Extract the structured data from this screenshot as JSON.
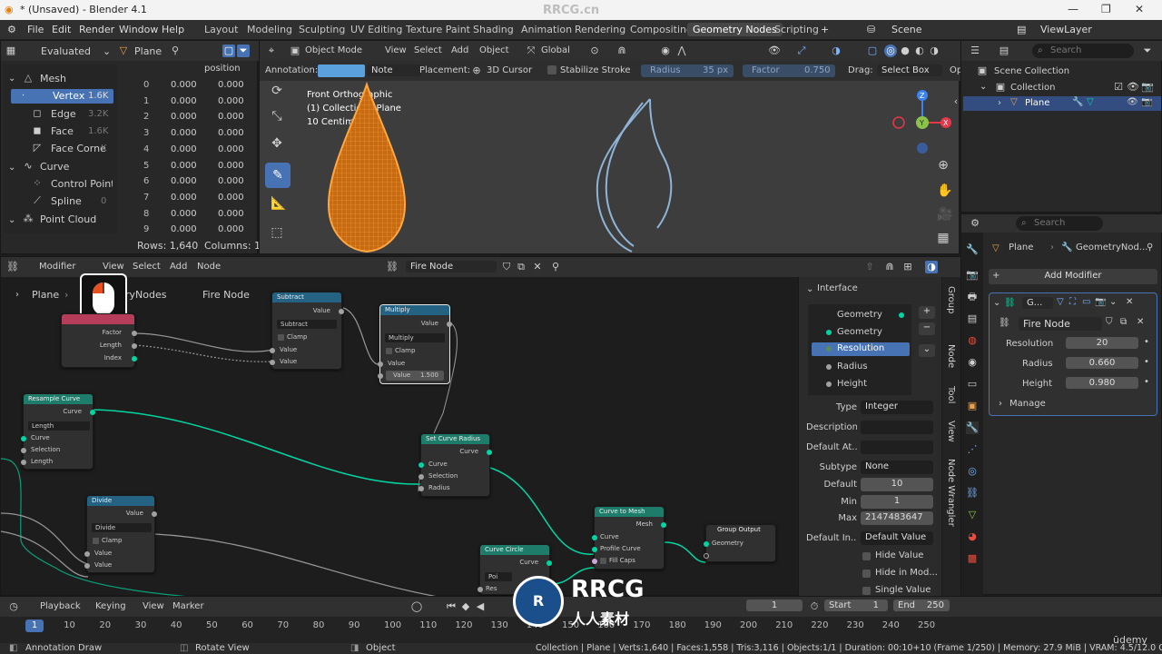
{
  "window": {
    "title": "* (Unsaved) - Blender 4.1"
  },
  "menu": {
    "items": [
      "File",
      "Edit",
      "Render",
      "Window",
      "Help"
    ]
  },
  "workspaces": [
    "Layout",
    "Modeling",
    "Sculpting",
    "UV Editing",
    "Texture Paint",
    "Shading",
    "Animation",
    "Rendering",
    "Compositing",
    "Geometry Nodes",
    "Scripting"
  ],
  "active_workspace": "Geometry Nodes",
  "scene": {
    "name": "Scene",
    "viewlayer": "ViewLayer"
  },
  "spreadsheet": {
    "mode": "Evaluated",
    "object": "Plane",
    "column": "position",
    "tree": [
      {
        "label": "Mesh",
        "count": ""
      },
      {
        "label": "Vertex",
        "count": "1.6K"
      },
      {
        "label": "Edge",
        "count": "3.2K"
      },
      {
        "label": "Face",
        "count": "1.6K"
      },
      {
        "label": "Face Corner",
        "count": "K"
      },
      {
        "label": "Curve",
        "count": ""
      },
      {
        "label": "Control Point",
        "count": ""
      },
      {
        "label": "Spline",
        "count": "0"
      },
      {
        "label": "Point Cloud",
        "count": ""
      }
    ],
    "rows": [
      {
        "i": "0",
        "a": "0.000",
        "b": "0.000"
      },
      {
        "i": "1",
        "a": "0.000",
        "b": "0.000"
      },
      {
        "i": "2",
        "a": "0.000",
        "b": "0.000"
      },
      {
        "i": "3",
        "a": "0.000",
        "b": "0.000"
      },
      {
        "i": "4",
        "a": "0.000",
        "b": "0.000"
      },
      {
        "i": "5",
        "a": "0.000",
        "b": "0.000"
      },
      {
        "i": "6",
        "a": "0.000",
        "b": "0.000"
      },
      {
        "i": "7",
        "a": "0.000",
        "b": "0.000"
      },
      {
        "i": "8",
        "a": "0.000",
        "b": "0.000"
      },
      {
        "i": "9",
        "a": "0.000",
        "b": "0.000"
      }
    ],
    "rows_label": "Rows: 1,640",
    "cols_label": "Columns: 1"
  },
  "viewport": {
    "mode": "Object Mode",
    "menus": [
      "View",
      "Select",
      "Add",
      "Object"
    ],
    "orientation": "Global",
    "annotation_label": "Annotation:",
    "note": "Note",
    "placement_label": "Placement:",
    "placement": "3D Cursor",
    "stabilize": "Stabilize Stroke",
    "radius_label": "Radius",
    "radius_val": "35 px",
    "factor_label": "Factor",
    "factor_val": "0.750",
    "drag_label": "Drag:",
    "drag": "Select Box",
    "op": "Op",
    "overlay_lines": [
      "Front Orthographic",
      "(1) Collection | Plane",
      "10 Centimeters"
    ]
  },
  "outliner": {
    "search": "Search",
    "scene_collection": "Scene Collection",
    "collection": "Collection",
    "plane": "Plane"
  },
  "properties": {
    "search": "Search",
    "breadcrumb_obj": "Plane",
    "breadcrumb_mod": "GeometryNod...",
    "add_modifier": "Add Modifier",
    "mod_name": "G...",
    "node_group": "Fire Node",
    "inputs": [
      {
        "label": "Resolution",
        "value": "20"
      },
      {
        "label": "Radius",
        "value": "0.660"
      },
      {
        "label": "Height",
        "value": "0.980"
      }
    ],
    "manage": "Manage"
  },
  "node_editor": {
    "menus": [
      "Modifier",
      "View",
      "Select",
      "Add",
      "Node"
    ],
    "group_name": "Fire Node",
    "breadcrumb_obj": "Plane",
    "breadcrumb_mod": "ryNodes",
    "breadcrumb_group": "Fire Node",
    "side_tabs": [
      "Group",
      "Node",
      "Tool",
      "View",
      "Node Wrangler"
    ],
    "nodes": {
      "subtract": {
        "title": "Subtract",
        "value": "Value",
        "mode": "Subtract",
        "clamp": "Clamp",
        "in1": "Value",
        "in2": "Value"
      },
      "multiply": {
        "title": "Multiply",
        "value": "Value",
        "mode": "Multiply",
        "clamp": "Clamp",
        "in1": "Value",
        "in2": "Value",
        "in2val": "1.500"
      },
      "spline": {
        "factor": "Factor",
        "length": "Length",
        "index": "Index"
      },
      "resample": {
        "title": "Resample Curve",
        "out": "Curve",
        "mode": "Length",
        "in1": "Curve",
        "in2": "Selection",
        "in3": "Length"
      },
      "setradius": {
        "title": "Set Curve Radius",
        "out": "Curve",
        "in1": "Curve",
        "in2": "Selection",
        "in3": "Radius"
      },
      "divide": {
        "title": "Divide",
        "out": "Value",
        "mode": "Divide",
        "clamp": "Clamp",
        "in1": "Value",
        "in2": "Value"
      },
      "curvetomesh": {
        "title": "Curve to Mesh",
        "out": "Mesh",
        "in1": "Curve",
        "in2": "Profile Curve",
        "in3": "Fill Caps"
      },
      "groupoutput": {
        "title": "Group Output",
        "in1": "Geometry"
      },
      "curvecircle": {
        "title": "Curve Circle",
        "out": "Curve",
        "in1": "Poi",
        "in2": "Res"
      }
    },
    "interface": {
      "title": "Interface",
      "items": [
        "Geometry",
        "Geometry",
        "Resolution",
        "Radius",
        "Height"
      ],
      "props": [
        {
          "label": "Type",
          "value": "Integer"
        },
        {
          "label": "Description",
          "value": ""
        },
        {
          "label": "Default At...",
          "value": ""
        },
        {
          "label": "Subtype",
          "value": "None"
        },
        {
          "label": "Default",
          "value": "10"
        },
        {
          "label": "Min",
          "value": "1"
        },
        {
          "label": "Max",
          "value": "2147483647"
        },
        {
          "label": "Default In...",
          "value": "Default Value"
        }
      ],
      "checks": [
        "Hide Value",
        "Hide in Mod...",
        "Single Value"
      ]
    }
  },
  "timeline": {
    "menus": [
      "Playback",
      "Keying",
      "View",
      "Marker"
    ],
    "current": "1",
    "start_label": "Start",
    "start": "1",
    "end_label": "End",
    "end": "250",
    "ticks": [
      "1",
      "10",
      "20",
      "30",
      "40",
      "50",
      "60",
      "70",
      "80",
      "90",
      "100",
      "110",
      "120",
      "130",
      "140",
      "150",
      "160",
      "170",
      "180",
      "190",
      "200",
      "210",
      "220",
      "230",
      "240",
      "250"
    ]
  },
  "status": {
    "left": "Annotation Draw",
    "mid": "Rotate View",
    "obj": "Object",
    "info": "Collection | Plane | Verts:1,640 | Faces:1,558 | Tris:3,116 | Objects:1/1 | Duration: 00:10+10 (Frame 1/250) | Memory: 27.9 MiB | VRAM: 4.5/12.0 GiB | 4"
  },
  "watermark": {
    "brand": "RRCG",
    "sub": "人人素材",
    "site": "RRCG.cn",
    "udemy": "ūdemy"
  }
}
